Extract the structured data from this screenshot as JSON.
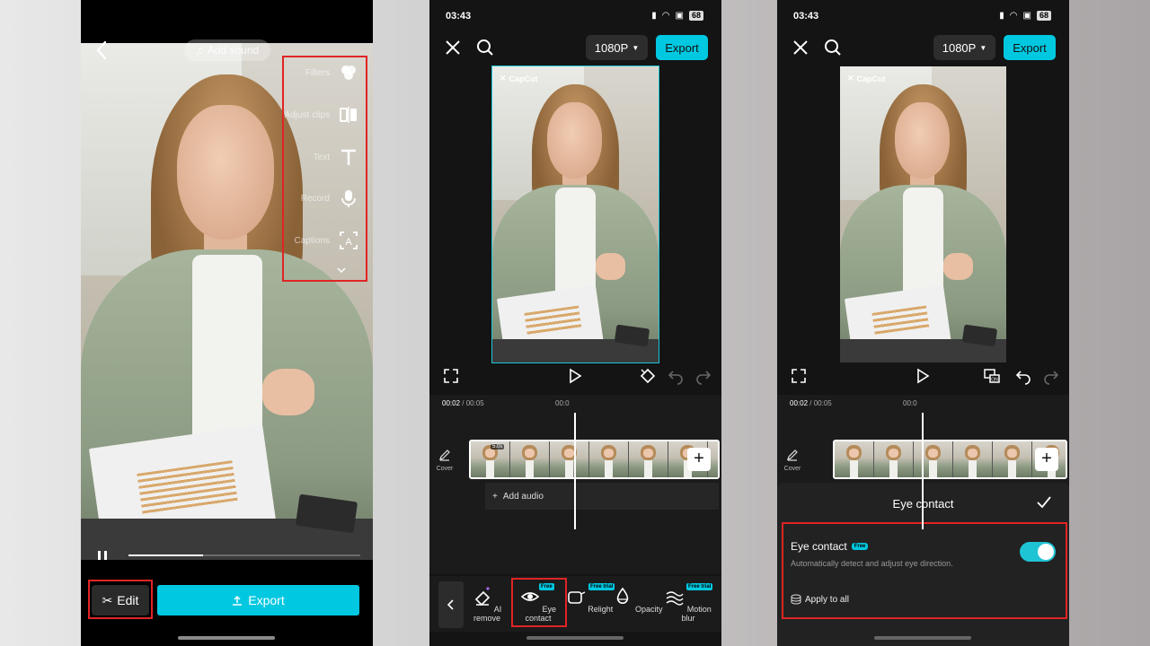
{
  "panel1": {
    "add_sound": "Add sound",
    "tools": [
      {
        "label": "Filters",
        "icon": "filters-icon"
      },
      {
        "label": "Adjust clips",
        "icon": "adjust-clips-icon"
      },
      {
        "label": "Text",
        "icon": "text-icon"
      },
      {
        "label": "Record",
        "icon": "microphone-icon"
      },
      {
        "label": "Captions",
        "icon": "captions-icon"
      }
    ],
    "edit_label": "Edit",
    "export_label": "Export",
    "progress": 0.32
  },
  "panel2": {
    "time": "03:43",
    "battery": "68",
    "resolution": "1080P",
    "export": "Export",
    "watermark": "CapCut",
    "timecode_current": "00:02",
    "timecode_total": "/ 00:05",
    "tick_label": "00:0",
    "clip_duration": "5.0s",
    "cover_label": "Cover",
    "add_audio": "Add audio",
    "tools": [
      {
        "label": "AI remove",
        "icon": "ai-remove-icon",
        "badge": ""
      },
      {
        "label": "Eye contact",
        "icon": "eye-contact-icon",
        "badge": "Free"
      },
      {
        "label": "Relight",
        "icon": "relight-icon",
        "badge": "Free trial"
      },
      {
        "label": "Opacity",
        "icon": "opacity-icon",
        "badge": ""
      },
      {
        "label": "Motion blur",
        "icon": "motion-blur-icon",
        "badge": "Free trial"
      }
    ]
  },
  "panel3": {
    "time": "03:43",
    "battery": "68",
    "resolution": "1080P",
    "export": "Export",
    "watermark": "CapCut",
    "timecode_current": "00:02",
    "timecode_total": "/ 00:05",
    "tick_label": "00:0",
    "cover_label": "Cover",
    "sheet_title": "Eye contact",
    "option_title": "Eye contact",
    "option_badge": "Free",
    "option_desc": "Automatically detect and adjust eye direction.",
    "toggle_on": true,
    "apply_all": "Apply to all"
  },
  "colors": {
    "accent": "#00c8e0",
    "highlight": "#e02424"
  }
}
